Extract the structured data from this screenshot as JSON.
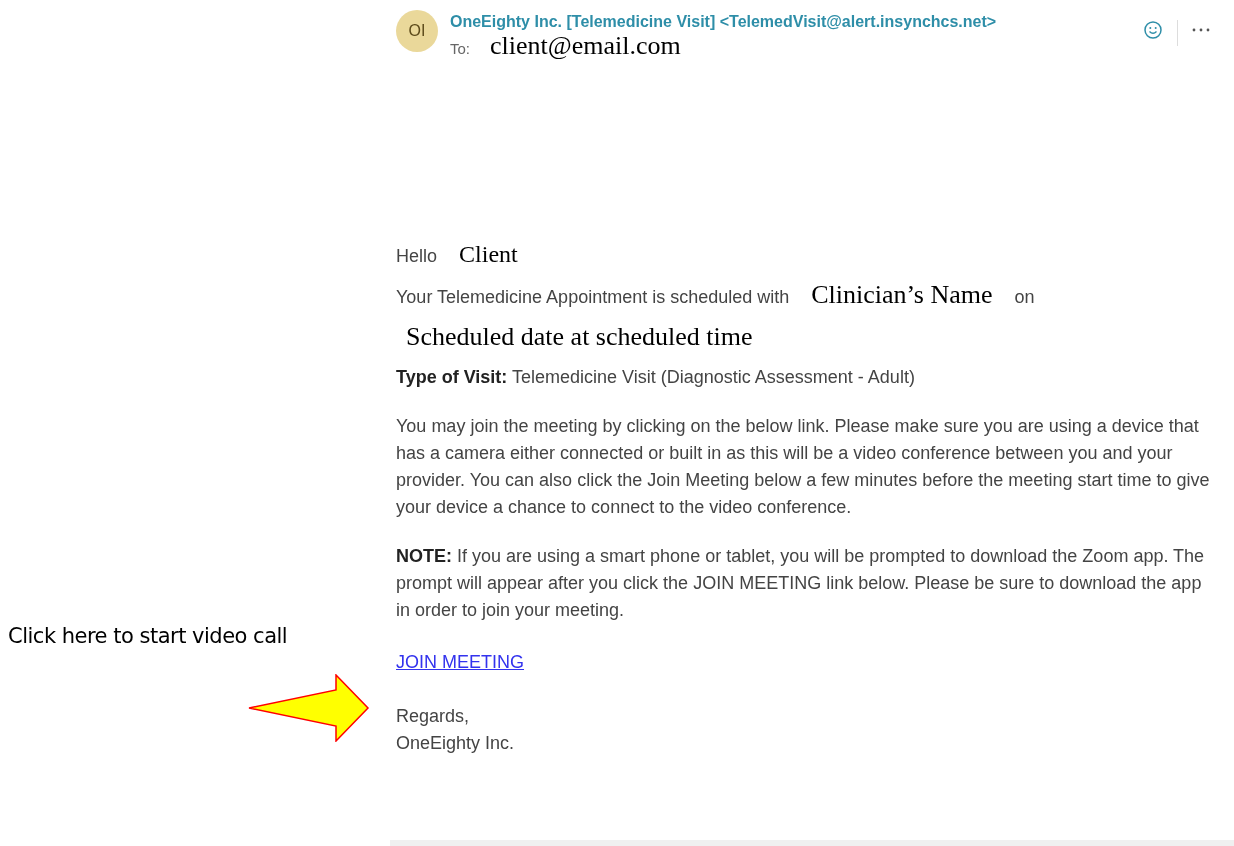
{
  "annotation": {
    "text": "Click here to start video call"
  },
  "email": {
    "avatar": "OI",
    "sender": "OneEighty Inc. [Telemedicine Visit] <TelemedVisit@alert.insynchcs.net>",
    "to_label": "To:",
    "to": "client@email.com",
    "greeting": {
      "text": "Hello",
      "name": "Client"
    },
    "schedule": {
      "text": "Your Telemedicine Appointment is scheduled with",
      "clinician": "Clinician’s Name",
      "connector": "on",
      "when": "Scheduled date at scheduled time"
    },
    "visit_type": "**Type of Visit:** Telemedicine Visit (Diagnostic Assessment - Adult)",
    "paragraphs": [
      "You may join the meeting by clicking on the below link. Please make sure you are using a device that has a camera either connected or built in as this will be a video conference between you and your provider. You can also click the Join Meeting below a few minutes before the meeting start time to give your device a chance to connect to the video conference.",
      "**NOTE:** If you are using a smart phone or tablet, you will be prompted to download the Zoom app. The prompt will appear after you click the JOIN MEETING link below. Please be sure to download the app in order to join your meeting."
    ],
    "link": "JOIN MEETING",
    "sign_off": [
      "Regards,",
      "OneEighty Inc."
    ]
  }
}
